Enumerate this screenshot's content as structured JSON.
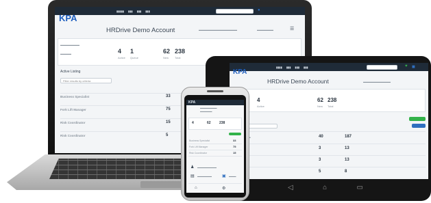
{
  "brand": {
    "logo": "KPA"
  },
  "laptop": {
    "account_title": "HRDrive Demo Account",
    "stats": [
      {
        "value": "4",
        "label": "Active"
      },
      {
        "value": "1",
        "label": "Queue"
      },
      {
        "value": "62",
        "label": "New"
      },
      {
        "value": "238",
        "label": "Total"
      }
    ],
    "section_label": "Active Listing",
    "search_placeholder": "Filter results by criteria",
    "listings": [
      {
        "title": "Business Specialist",
        "value": "33"
      },
      {
        "title": "Fork Lift Manager",
        "value": "75"
      },
      {
        "title": "Risk Coordinator",
        "value": "15"
      },
      {
        "title": "Risk Coordinator",
        "value": "5"
      }
    ]
  },
  "tablet": {
    "account_title": "HRDrive Demo Account",
    "stats": [
      {
        "value": "4",
        "label": "Active"
      },
      {
        "value": "62",
        "label": "New"
      },
      {
        "value": "238",
        "label": "Total"
      }
    ],
    "rows": [
      {
        "a": "40",
        "b": "187"
      },
      {
        "a": "3",
        "b": "13"
      },
      {
        "a": "3",
        "b": "13"
      },
      {
        "a": "5",
        "b": "8"
      }
    ]
  },
  "phone": {
    "rows": [
      {
        "label": "Business Specialist",
        "value": "33"
      },
      {
        "label": "Fork Lift Manager",
        "value": "75"
      },
      {
        "label": "Risk Coordinator",
        "value": "15"
      }
    ]
  },
  "colors": {
    "topbar": "#1f2b38",
    "accent_blue": "#2f6fbf",
    "accent_green": "#33b24a"
  }
}
